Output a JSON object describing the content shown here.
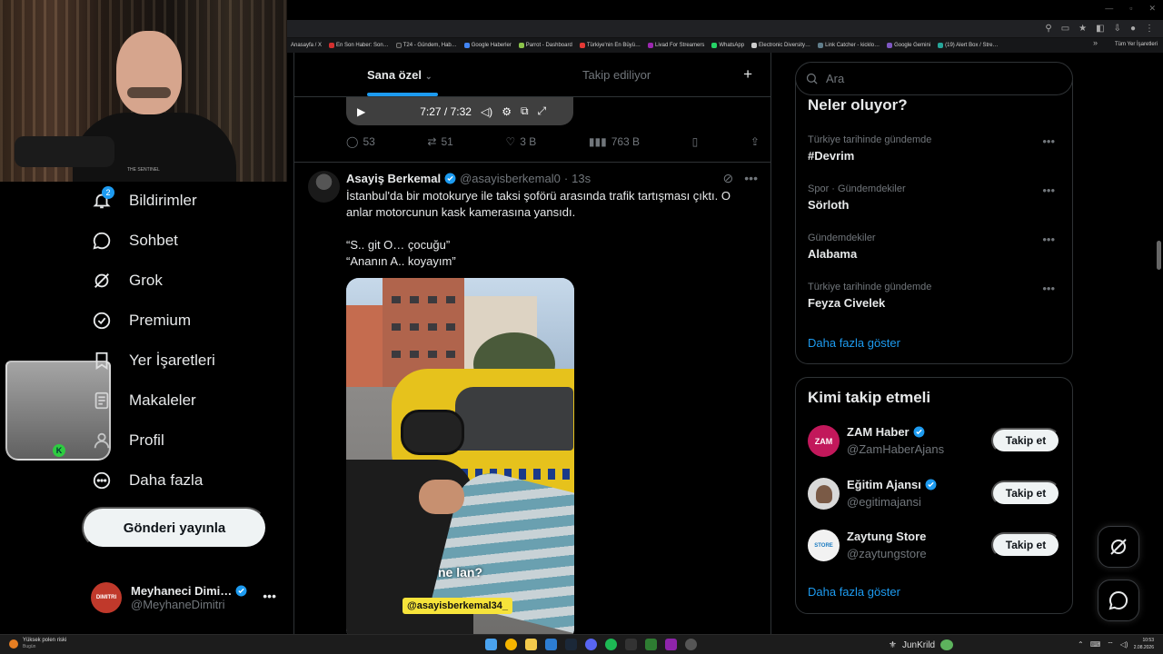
{
  "browser": {
    "bookmarks": [
      "Anasayfa / X",
      "En Son Haber: Son…",
      "T24 - Gündem, Hab…",
      "Google Haberler",
      "Parrot - Dashboard",
      "Türkiye'nin En Büyü…",
      "Livad For Streamers",
      "WhatsApp",
      "Electronic Diversity…",
      "Link Catcher - kicklo…",
      "Google Gemini",
      "(19) Alert Box / Stre…"
    ],
    "all_bookmarks": "Tüm Yer İşaretleri",
    "more": "»"
  },
  "webcam": {
    "emblem": "THE SENTINEL"
  },
  "nav": {
    "items": [
      {
        "label": "Bildirimler",
        "icon": "bell-icon",
        "badge": "2"
      },
      {
        "label": "Sohbet",
        "icon": "chat-icon"
      },
      {
        "label": "Grok",
        "icon": "grok-icon"
      },
      {
        "label": "Premium",
        "icon": "premium-icon"
      },
      {
        "label": "Yer İşaretleri",
        "icon": "bookmark-icon"
      },
      {
        "label": "Makaleler",
        "icon": "article-icon"
      },
      {
        "label": "Profil",
        "icon": "person-icon"
      },
      {
        "label": "Daha fazla",
        "icon": "more-circle-icon"
      }
    ],
    "post_button": "Gönderi yayınla",
    "profile": {
      "name": "Meyhaneci Dimi…",
      "handle": "@MeyhaneDimitri",
      "avatar_text": "DIMITRI"
    }
  },
  "feed": {
    "tabs": {
      "for_you": "Sana özel",
      "following": "Takip ediliyor"
    },
    "video_player": {
      "time": "7:27 / 7:32"
    },
    "prev_actions": {
      "replies": "53",
      "reposts": "51",
      "likes": "3 B",
      "views": "763 B"
    },
    "tweet": {
      "name": "Asayiş Berkemal",
      "handle": "@asayisberkemal0",
      "time": "13s",
      "text_lines": [
        "İstanbul'da bir motokurye ile taksi şoförü arasında trafik tartışması çıktı. O anlar motorcunun kask kamerasına yansıdı.",
        "“S.. git O… çocuğu”",
        "“Ananın A.. koyayım”"
      ],
      "media_caption": "ne lan?",
      "media_tag": "@asayisberkemal34_"
    }
  },
  "sidebar": {
    "search_placeholder": "Ara",
    "trends_title": "Neler oluyor?",
    "trends": [
      {
        "context": "Türkiye tarihinde gündemde",
        "title": "#Devrim"
      },
      {
        "context": "Spor · Gündemdekiler",
        "title": "Sörloth"
      },
      {
        "context": "Gündemdekiler",
        "title": "Alabama"
      },
      {
        "context": "Türkiye tarihinde gündemde",
        "title": "Feyza Civelek"
      }
    ],
    "show_more": "Daha fazla göster",
    "who_title": "Kimi takip etmeli",
    "who": [
      {
        "name": "ZAM Haber",
        "handle": "@ZamHaberAjans",
        "button": "Takip et",
        "avatar_text": "ZAM",
        "color": "#c2185b"
      },
      {
        "name": "Eğitim Ajansı",
        "handle": "@egitimajansi",
        "button": "Takip et",
        "avatar_text": "",
        "color": "#d9d9d9"
      },
      {
        "name": "Zaytung Store",
        "handle": "@zaytungstore",
        "button": "Takip et",
        "avatar_text": "STORE",
        "color": "#f2f2f2"
      }
    ],
    "show_more_2": "Daha fazla göster"
  },
  "taskbar": {
    "weather_title": "Yüksek polen riski",
    "weather_sub": "Bugün",
    "user": "JunKrild",
    "time": "10:53",
    "date": "2.08.2026"
  },
  "colors": {
    "accent": "#1d9bf0",
    "bg": "#000000",
    "muted": "#71767b"
  }
}
